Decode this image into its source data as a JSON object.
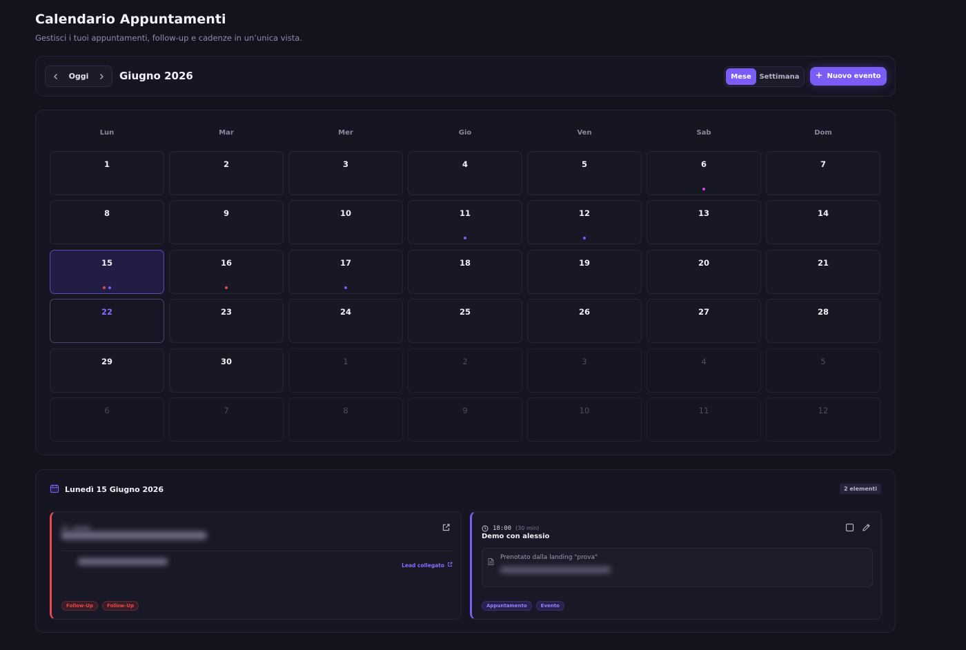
{
  "header": {
    "title": "Calendario Appuntamenti",
    "subtitle": "Gestisci i tuoi appuntamenti, follow-up e cadenze in un’unica vista."
  },
  "toolbar": {
    "today_label": "Oggi",
    "month_label": "Giugno 2026",
    "views": [
      "Mese",
      "Settimana"
    ],
    "active_view": "Mese",
    "new_event_label": "Nuovo evento"
  },
  "colors": {
    "accent": "#7b5cf6",
    "followup": "#e5484d",
    "dot_pink": "#d946ef",
    "dot_purple": "#7b5cf6",
    "dot_red": "#e5484d"
  },
  "calendar": {
    "weekdays": [
      "Lun",
      "Mar",
      "Mer",
      "Gio",
      "Ven",
      "Sab",
      "Dom"
    ],
    "days": [
      {
        "n": "1"
      },
      {
        "n": "2"
      },
      {
        "n": "3"
      },
      {
        "n": "4"
      },
      {
        "n": "5"
      },
      {
        "n": "6",
        "dots": [
          "dot_pink"
        ]
      },
      {
        "n": "7"
      },
      {
        "n": "8"
      },
      {
        "n": "9"
      },
      {
        "n": "10"
      },
      {
        "n": "11",
        "dots": [
          "dot_purple"
        ]
      },
      {
        "n": "12",
        "dots": [
          "dot_purple"
        ]
      },
      {
        "n": "13"
      },
      {
        "n": "14"
      },
      {
        "n": "15",
        "state": "selected",
        "dots": [
          "dot_red",
          "dot_purple"
        ]
      },
      {
        "n": "16",
        "dots": [
          "dot_red"
        ]
      },
      {
        "n": "17",
        "dots": [
          "dot_purple"
        ]
      },
      {
        "n": "18"
      },
      {
        "n": "19"
      },
      {
        "n": "20"
      },
      {
        "n": "21"
      },
      {
        "n": "22",
        "state": "today"
      },
      {
        "n": "23"
      },
      {
        "n": "24"
      },
      {
        "n": "25"
      },
      {
        "n": "26"
      },
      {
        "n": "27"
      },
      {
        "n": "28"
      },
      {
        "n": "29"
      },
      {
        "n": "30"
      },
      {
        "n": "1",
        "state": "outside"
      },
      {
        "n": "2",
        "state": "outside"
      },
      {
        "n": "3",
        "state": "outside"
      },
      {
        "n": "4",
        "state": "outside"
      },
      {
        "n": "5",
        "state": "outside"
      },
      {
        "n": "6",
        "state": "outside"
      },
      {
        "n": "7",
        "state": "outside"
      },
      {
        "n": "8",
        "state": "outside"
      },
      {
        "n": "9",
        "state": "outside"
      },
      {
        "n": "10",
        "state": "outside"
      },
      {
        "n": "11",
        "state": "outside"
      },
      {
        "n": "12",
        "state": "outside"
      }
    ]
  },
  "agenda": {
    "date_label": "Lunedì 15 Giugno 2026",
    "count_label": "2 elementi",
    "left_event": {
      "lead_link_label": "Lead collegato",
      "tags": [
        "Follow-Up",
        "Follow-Up"
      ]
    },
    "right_event": {
      "time": "18:00",
      "duration": "(30 min)",
      "title": "Demo con alessio",
      "note": "Prenotato dalla landing \"prova\"",
      "tags": [
        "Appuntamento",
        "Evento"
      ]
    }
  }
}
